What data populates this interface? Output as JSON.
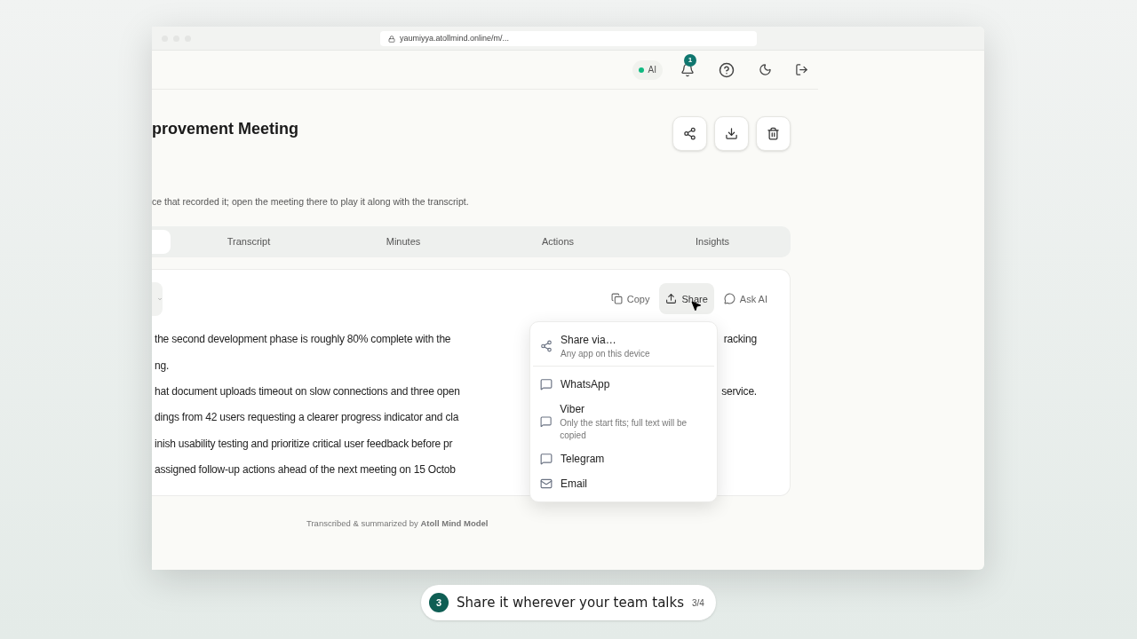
{
  "browser": {
    "url": "yaumiyya.atollmind.online/m/..."
  },
  "header": {
    "ai_status": {
      "label": "AI",
      "on": true
    },
    "notifications": {
      "count": "1"
    }
  },
  "meeting": {
    "title": "provement Meeting",
    "note": "ce that recorded it; open the meeting there to play it along with the transcript."
  },
  "tabs": [
    {
      "selected": true
    },
    {
      "label": "Transcript",
      "selected": false
    },
    {
      "label": "Minutes",
      "selected": false
    },
    {
      "label": "Actions",
      "selected": false
    },
    {
      "label": "Insights",
      "selected": false
    }
  ],
  "toolbar": [
    {
      "kind": "copy",
      "label": "Copy",
      "selected": false
    },
    {
      "kind": "share",
      "label": "Share",
      "selected": true
    },
    {
      "kind": "ask",
      "label": "Ask AI",
      "selected": false
    }
  ],
  "summary_lines": [
    {
      "left": "the second development phase is roughly 80% complete with the",
      "right": "racking"
    },
    {
      "left": "ng."
    },
    {
      "left": "hat document uploads timeout on slow connections and three open",
      "right": "service."
    },
    {
      "left": "dings from 42 users requesting a clearer progress indicator and cla"
    },
    {
      "left": "inish usability testing and prioritize critical user feedback before pr"
    },
    {
      "left": "assigned follow-up actions ahead of the next meeting on 15 Octob"
    }
  ],
  "share_menu": [
    {
      "kind": "device",
      "label": "Share via…",
      "detail": "Any app on this device"
    },
    {
      "kind": "chat",
      "label": "WhatsApp"
    },
    {
      "kind": "chat",
      "label": "Viber",
      "detail": "Only the start fits; full text will be copied"
    },
    {
      "kind": "chat",
      "label": "Telegram"
    },
    {
      "kind": "email",
      "label": "Email"
    }
  ],
  "footer": "Transcribed & summarized by **Atoll Mind Model**",
  "tour": {
    "step": "3",
    "caption": "Share it wherever your team talks",
    "progress": "3/4"
  }
}
